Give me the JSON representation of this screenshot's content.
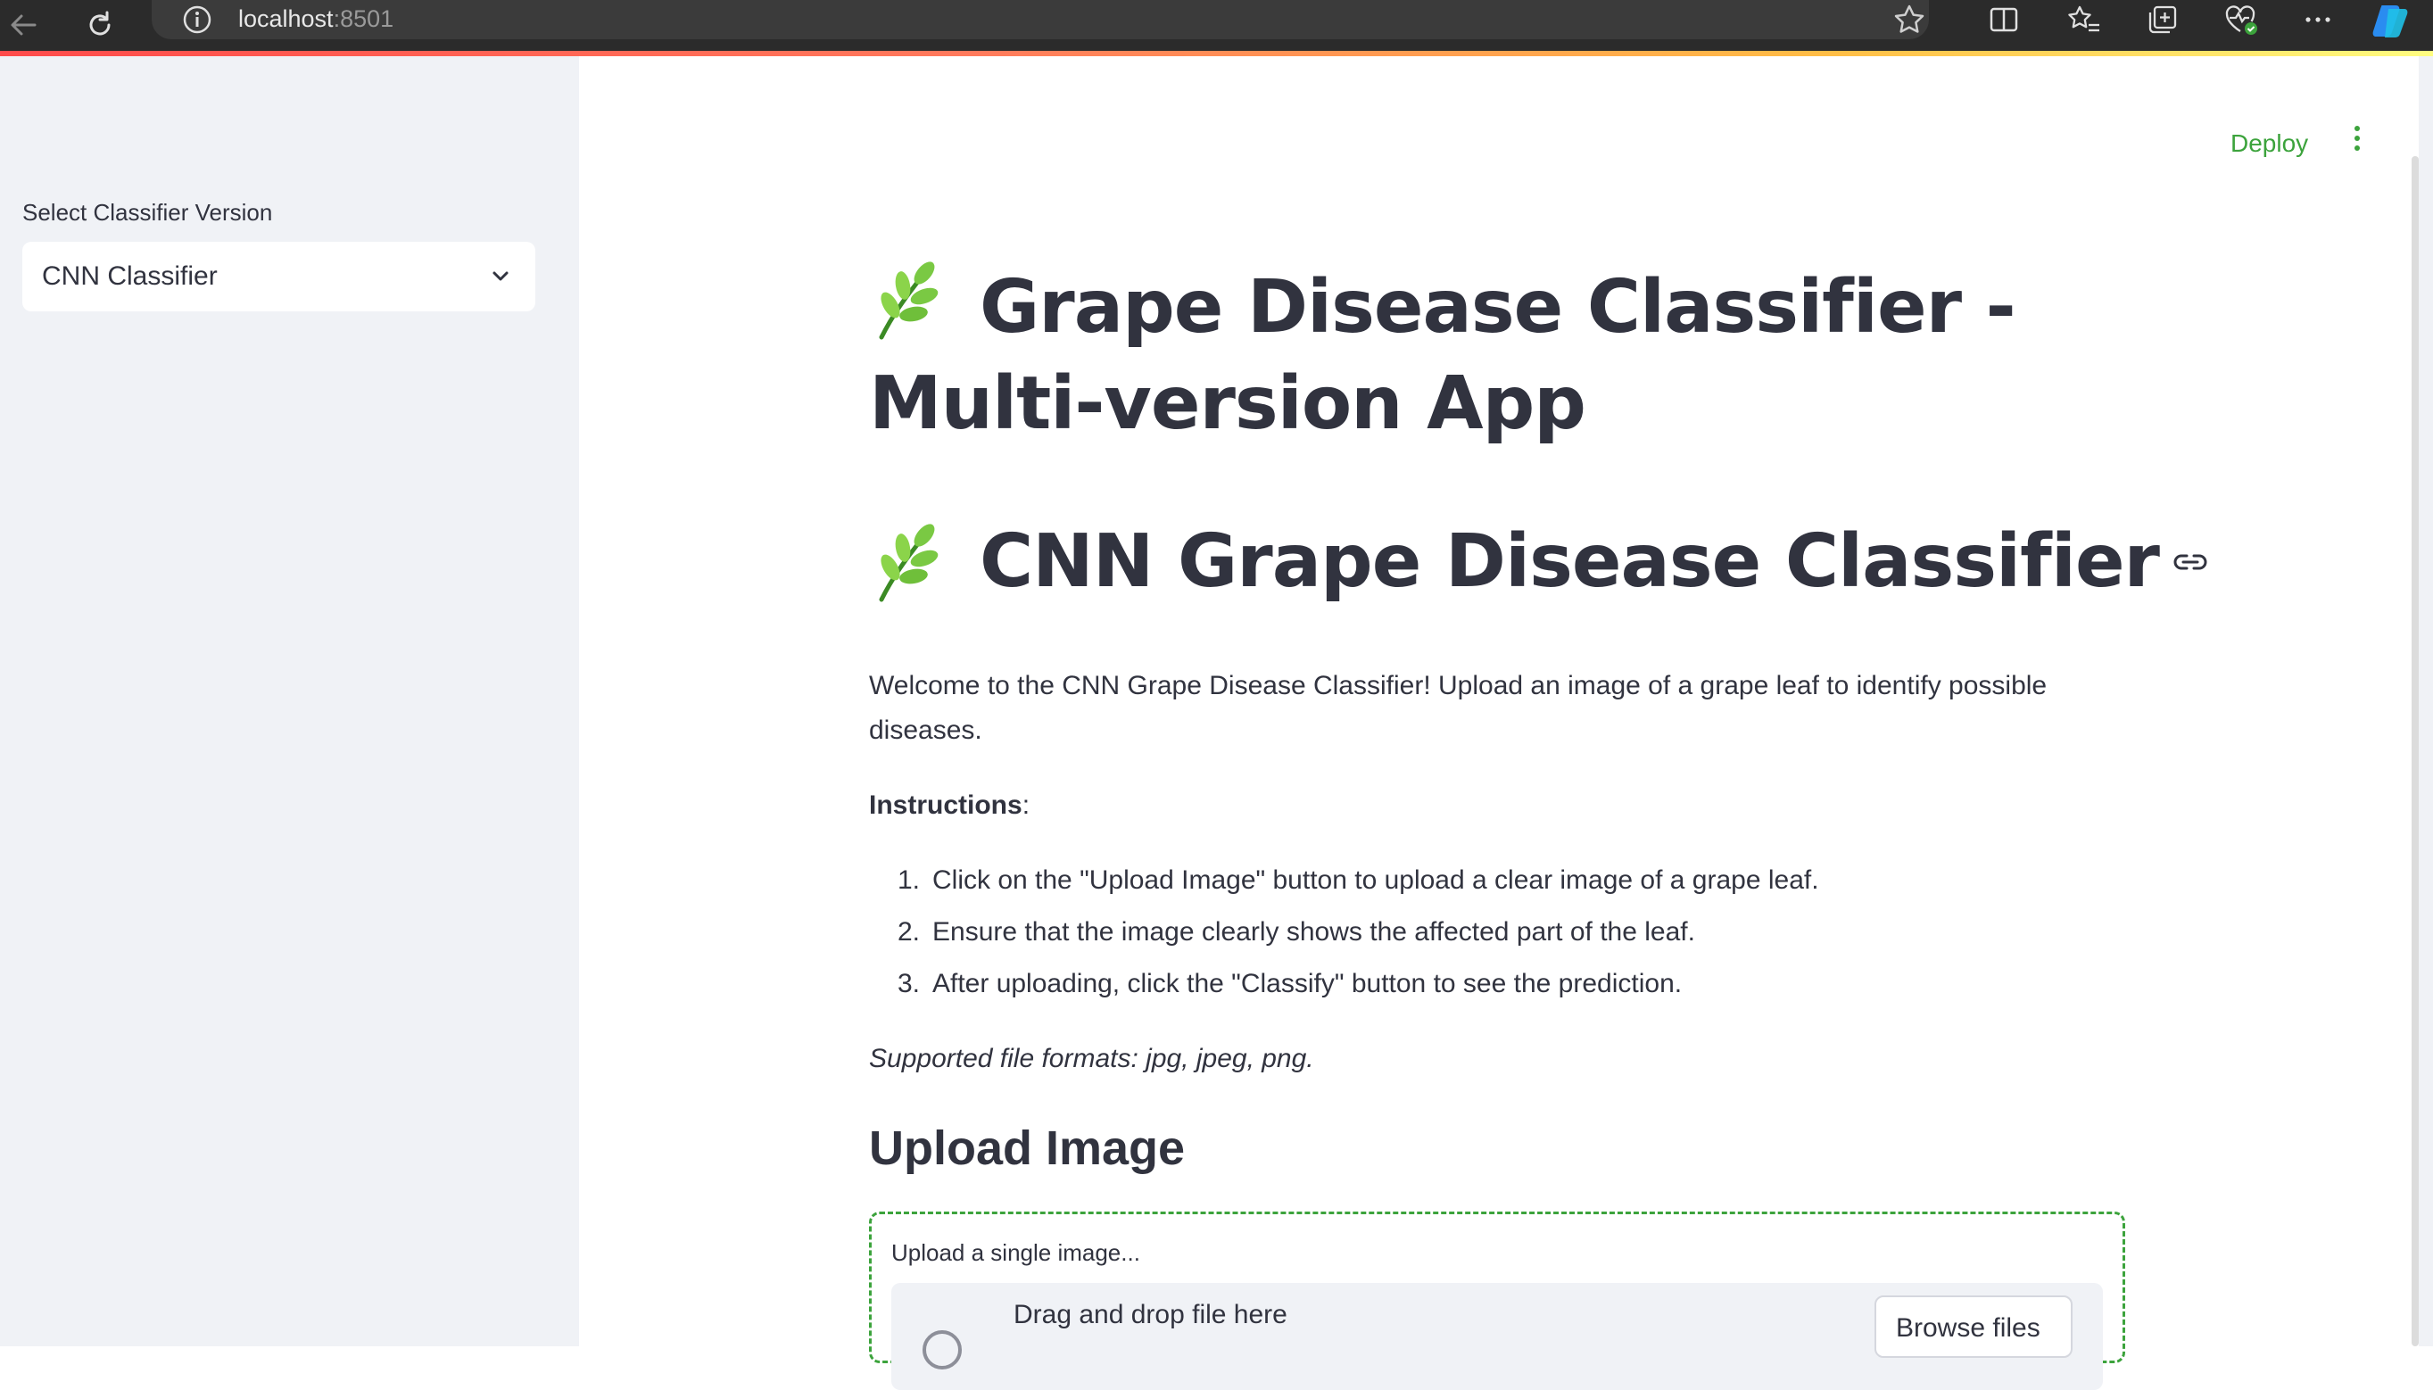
{
  "browser": {
    "url_host": "localhost",
    "url_port": ":8501"
  },
  "sidebar": {
    "select_label": "Select Classifier Version",
    "select_value": "CNN Classifier"
  },
  "header": {
    "deploy_label": "Deploy"
  },
  "main": {
    "title": "Grape Disease Classifier - Multi-version App",
    "subtitle": "CNN Grape Disease Classifier",
    "welcome": "Welcome to the CNN Grape Disease Classifier! Upload an image of a grape leaf to identify possible diseases.",
    "instructions_title": "Instructions",
    "instructions_colon": ":",
    "instructions": [
      {
        "num": "1.",
        "text": "Click on the \"Upload Image\" button to upload a clear image of a grape leaf."
      },
      {
        "num": "2.",
        "text": "Ensure that the image clearly shows the affected part of the leaf."
      },
      {
        "num": "3.",
        "text": "After uploading, click the \"Classify\" button to see the prediction."
      }
    ],
    "formats_note": "Supported file formats: jpg, jpeg, png.",
    "upload_heading": "Upload Image",
    "uploader_label": "Upload a single image...",
    "dropzone_text": "Drag and drop file here",
    "browse_label": "Browse files"
  },
  "icons": {
    "back": "back-arrow-icon",
    "reload": "reload-icon",
    "info": "info-icon",
    "favorite": "star-icon",
    "split": "split-screen-icon",
    "favorites": "favorites-icon",
    "collections": "collections-icon",
    "health": "browser-essentials-icon",
    "more": "more-icon",
    "copilot": "copilot-icon",
    "leaf": "leaf-emoji-icon",
    "link": "link-icon",
    "chevron": "chevron-down-icon",
    "kebab": "kebab-menu-icon",
    "upload": "cloud-upload-icon"
  },
  "colors": {
    "accent_green": "#3ca33c",
    "text": "#31333f",
    "sidebar_bg": "#f0f2f6",
    "chrome_bg": "#2b2b2b"
  }
}
